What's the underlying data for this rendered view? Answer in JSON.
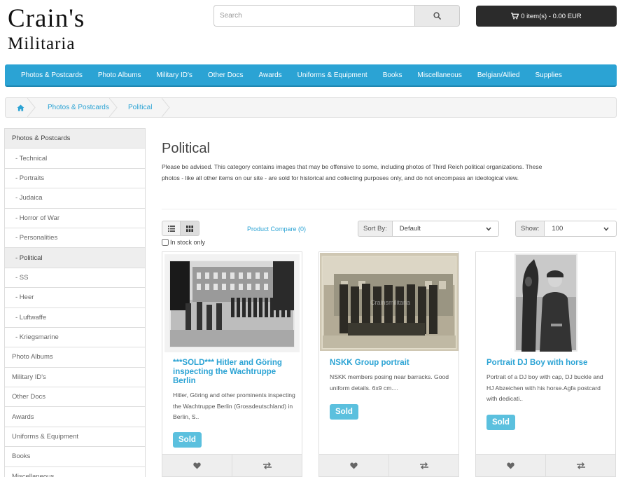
{
  "logo": {
    "line1": "Crain's",
    "line2": "Militaria"
  },
  "search": {
    "placeholder": "Search",
    "value": ""
  },
  "cart": {
    "label": "0 item(s) - 0.00 EUR"
  },
  "nav": [
    "Photos & Postcards",
    "Photo Albums",
    "Military ID's",
    "Other Docs",
    "Awards",
    "Uniforms & Equipment",
    "Books",
    "Miscellaneous",
    "Belgian/Allied",
    "Supplies"
  ],
  "breadcrumb": [
    "Photos & Postcards",
    "Political"
  ],
  "sidebar": [
    {
      "label": "Photos & Postcards",
      "sub": false,
      "active": true
    },
    {
      "label": " - Technical",
      "sub": true,
      "active": false
    },
    {
      "label": " - Portraits",
      "sub": true,
      "active": false
    },
    {
      "label": " - Judaica",
      "sub": true,
      "active": false
    },
    {
      "label": " - Horror of War",
      "sub": true,
      "active": false
    },
    {
      "label": " - Personalities",
      "sub": true,
      "active": false
    },
    {
      "label": " - Political",
      "sub": true,
      "active": true
    },
    {
      "label": " - SS",
      "sub": true,
      "active": false
    },
    {
      "label": " - Heer",
      "sub": true,
      "active": false
    },
    {
      "label": " - Luftwaffe",
      "sub": true,
      "active": false
    },
    {
      "label": " - Kriegsmarine",
      "sub": true,
      "active": false
    },
    {
      "label": "Photo Albums",
      "sub": false,
      "active": false
    },
    {
      "label": "Military ID's",
      "sub": false,
      "active": false
    },
    {
      "label": "Other Docs",
      "sub": false,
      "active": false
    },
    {
      "label": "Awards",
      "sub": false,
      "active": false
    },
    {
      "label": "Uniforms & Equipment",
      "sub": false,
      "active": false
    },
    {
      "label": "Books",
      "sub": false,
      "active": false
    },
    {
      "label": "Miscellaneous",
      "sub": false,
      "active": false
    }
  ],
  "page": {
    "title": "Political",
    "description": "Please be advised. This category contains images that may be offensive to some, including photos of Third Reich political organizations. These photos - like all other items on our site - are sold for historical and collecting purposes only, and do not encompass an ideological view."
  },
  "toolbar": {
    "compare": "Product Compare (0)",
    "instock": "In stock only",
    "sort_label": "Sort By:",
    "sort_value": "Default",
    "show_label": "Show:",
    "show_value": "100"
  },
  "products": [
    {
      "name": "***SOLD*** Hitler and Göring inspecting the Wachtruppe Berlin",
      "desc": "Hitler, Göring and other prominents inspecting the Wachtruppe Berlin (Grossdeutschland) in Berlin, S..",
      "badge": "Sold"
    },
    {
      "name": "NSKK Group portrait",
      "desc": "NSKK members posing near barracks.  Good uniform details.  6x9 cm....",
      "badge": "Sold"
    },
    {
      "name": "Portrait DJ Boy with horse",
      "desc": "Portrait of a DJ boy with cap, DJ buckle and HJ Abzeichen with his horse.Agfa postcard with dedicati..",
      "badge": "Sold"
    }
  ],
  "colors": {
    "accent": "#2ba3d4",
    "badge": "#5bc0de",
    "cart": "#2b2b2b"
  }
}
